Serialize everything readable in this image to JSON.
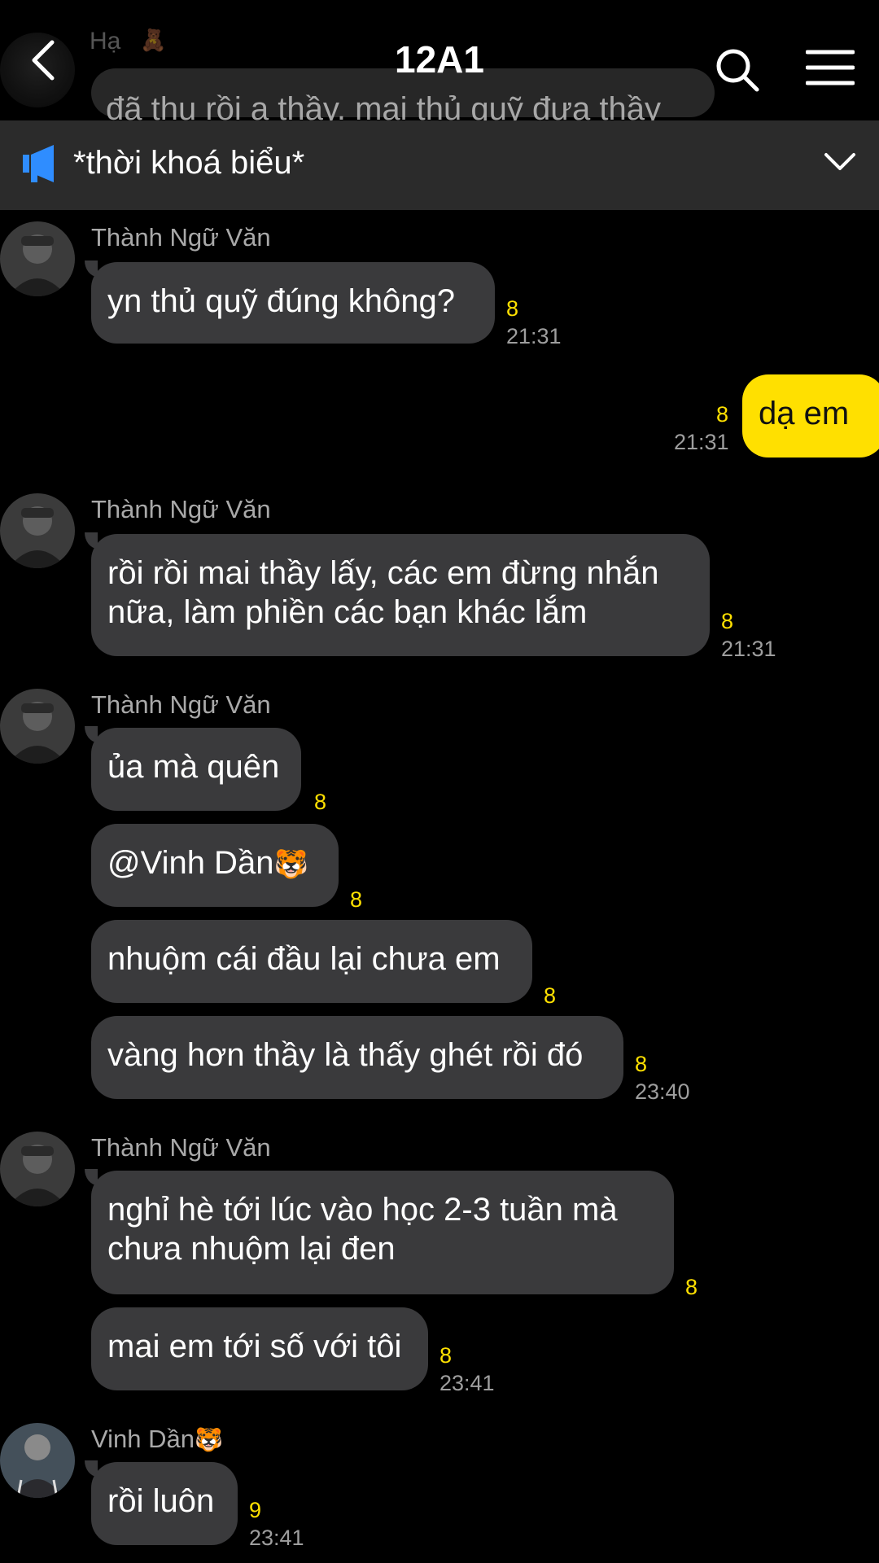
{
  "header": {
    "title": "12A1",
    "ghost_sender": "Hạ",
    "ghost_sender_emoji": "🧸",
    "ghost_text": "đã thu rồi ạ thầy. mai thủ quỹ đưa thầy"
  },
  "pinned": {
    "title": "*thời khoá biểu*"
  },
  "messages": [
    {
      "sender": "Thành Ngữ Văn",
      "text": "yn thủ quỹ đúng không?",
      "count": "8",
      "time": "21:31"
    },
    {
      "text": "dạ em",
      "count": "8",
      "time": "21:31"
    },
    {
      "sender": "Thành Ngữ Văn",
      "lines": [
        "rồi rồi mai thầy lấy, các em đừng nhắn",
        "nữa, làm phiền các bạn khác lắm"
      ],
      "count": "8",
      "time": "21:31"
    },
    {
      "sender": "Thành Ngữ Văn",
      "text": "ủa mà quên",
      "count": "8"
    },
    {
      "text": "@Vinh Dần",
      "emoji": "🐯",
      "count": "8"
    },
    {
      "text": "nhuộm cái đầu lại chưa em",
      "count": "8"
    },
    {
      "text": "vàng hơn thầy là thấy ghét rồi đó",
      "count": "8",
      "time": "23:40"
    },
    {
      "sender": "Thành Ngữ Văn",
      "lines": [
        "nghỉ hè tới lúc vào học 2-3 tuần mà",
        "chưa nhuộm lại đen"
      ],
      "count": "8"
    },
    {
      "text": "mai em tới số với tôi",
      "count": "8",
      "time": "23:41"
    },
    {
      "sender": "Vinh Dần",
      "sender_emoji": "🐯",
      "text": "rồi luôn",
      "count": "9",
      "time": "23:41"
    }
  ]
}
